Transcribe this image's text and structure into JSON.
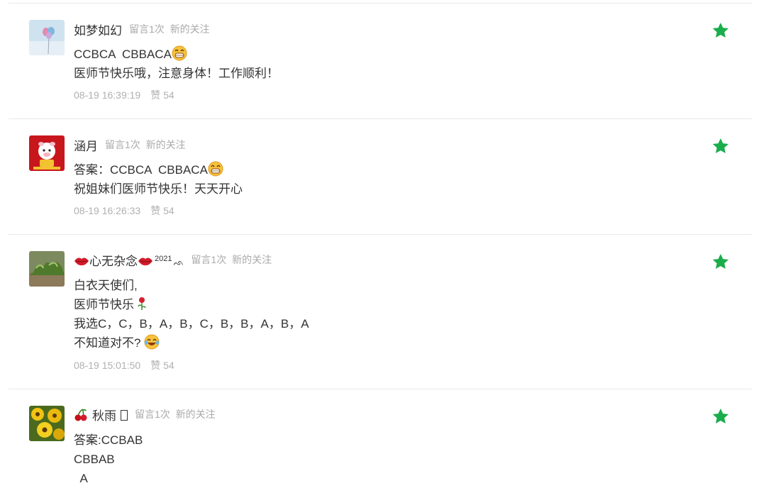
{
  "colors": {
    "accent_star": "#1aad4c",
    "meta": "#aaaaaa",
    "text": "#333333"
  },
  "comments": [
    {
      "nickname": "如梦如幻",
      "badge_count": "留言1次",
      "badge_follow": "新的关注",
      "line1": "CCBCA  CBBACA",
      "line2": "医师节快乐哦，注意身体！工作顺利！",
      "time": "08-19 16:39:19",
      "likes": "赞 54",
      "emoji_icon": "grin-emoji-icon"
    },
    {
      "nickname": "涵月",
      "badge_count": "留言1次",
      "badge_follow": "新的关注",
      "line1": "答案：CCBCA  CBBACA",
      "line2": "祝姐妹们医师节快乐！天天开心",
      "time": "08-19 16:26:33",
      "likes": "赞 54",
      "emoji_icon": "grin-emoji-icon"
    },
    {
      "nickname": "心无杂念",
      "nickname_sup": "2021",
      "badge_count": "留言1次",
      "badge_follow": "新的关注",
      "line1": "白衣天使们,",
      "line2": "医师节快乐",
      "line3": "我选C，C，B，A，B，C，B，B，A，B，A",
      "line4": "不知道对不?",
      "time": "08-19 15:01:50",
      "likes": "赞 54",
      "icons": [
        "lips-icon",
        "rose-icon",
        "laugh-tears-emoji-icon"
      ]
    },
    {
      "nickname": "秋雨",
      "badge_count": "留言1次",
      "badge_follow": "新的关注",
      "line1": "答案:CCBAB",
      "line2": "CBBAB",
      "line3": "  A",
      "icons": [
        "cherry-icon"
      ]
    }
  ]
}
